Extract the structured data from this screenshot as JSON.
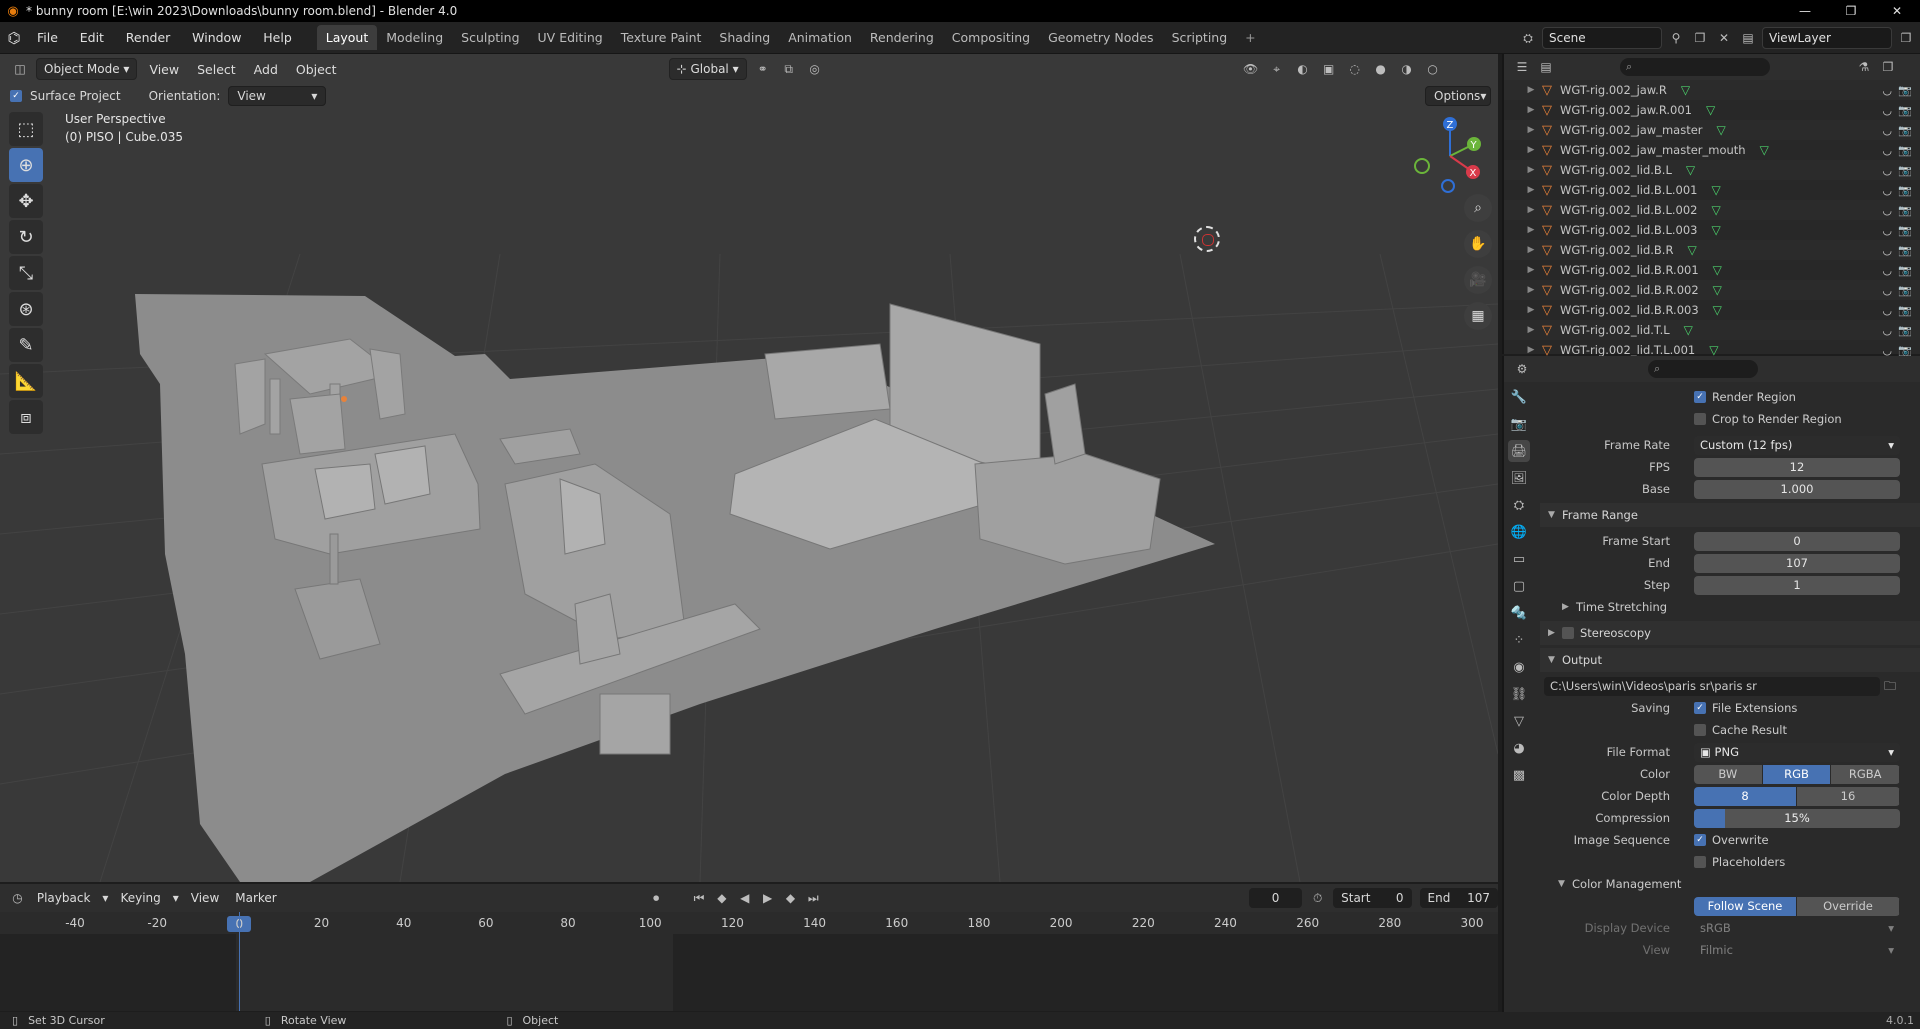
{
  "window": {
    "title": "* bunny room [E:\\win 2023\\Downloads\\bunny room.blend] - Blender 4.0",
    "min_glyph": "—",
    "max_glyph": "❐",
    "close_glyph": "✕"
  },
  "menu": [
    "File",
    "Edit",
    "Render",
    "Window",
    "Help"
  ],
  "workspaces": {
    "tabs": [
      "Layout",
      "Modeling",
      "Sculpting",
      "UV Editing",
      "Texture Paint",
      "Shading",
      "Animation",
      "Rendering",
      "Compositing",
      "Geometry Nodes",
      "Scripting"
    ],
    "active": "Layout",
    "add_glyph": "+"
  },
  "scene_selector": {
    "scene": "Scene",
    "view_layer": "ViewLayer"
  },
  "viewport": {
    "mode": "Object Mode",
    "menus": [
      "View",
      "Select",
      "Add",
      "Object"
    ],
    "transform_orientation": "Global",
    "surface_project_label": "Surface Project",
    "orientation_label": "Orientation:",
    "orientation_value": "View",
    "options_label": "Options",
    "perspective_text": "User Perspective",
    "object_text": "(0) PISO | Cube.035",
    "gizmo": {
      "x": "X",
      "y": "Y",
      "z": "Z"
    }
  },
  "timeline": {
    "menus": [
      "Playback",
      "Keying",
      "View",
      "Marker"
    ],
    "current_frame": "0",
    "start_label": "Start",
    "start_value": "0",
    "end_label": "End",
    "end_value": "107",
    "ruler": [
      "-40",
      "-20",
      "0",
      "20",
      "40",
      "60",
      "80",
      "100",
      "120",
      "140",
      "160",
      "180",
      "200",
      "220",
      "240",
      "260",
      "280",
      "300"
    ],
    "ruler_values": [
      -40,
      -20,
      0,
      20,
      40,
      60,
      80,
      100,
      120,
      140,
      160,
      180,
      200,
      220,
      240,
      260,
      280,
      300
    ],
    "playhead_frame": 0
  },
  "status_bar": {
    "left": "Set 3D Cursor",
    "middle": "Rotate View",
    "right": "Object",
    "version": "4.0.1"
  },
  "outliner": {
    "items": [
      "WGT-rig.002_jaw.R",
      "WGT-rig.002_jaw.R.001",
      "WGT-rig.002_jaw_master",
      "WGT-rig.002_jaw_master_mouth",
      "WGT-rig.002_lid.B.L",
      "WGT-rig.002_lid.B.L.001",
      "WGT-rig.002_lid.B.L.002",
      "WGT-rig.002_lid.B.L.003",
      "WGT-rig.002_lid.B.R",
      "WGT-rig.002_lid.B.R.001",
      "WGT-rig.002_lid.B.R.002",
      "WGT-rig.002_lid.B.R.003",
      "WGT-rig.002_lid.T.L",
      "WGT-rig.002_lid.T.L.001"
    ]
  },
  "properties": {
    "render_region": "Render Region",
    "crop_region": "Crop to Render Region",
    "frame_rate_label": "Frame Rate",
    "frame_rate_value": "Custom (12 fps)",
    "fps_label": "FPS",
    "fps_value": "12",
    "base_label": "Base",
    "base_value": "1.000",
    "frame_range_title": "Frame Range",
    "frame_start_label": "Frame Start",
    "frame_start_value": "0",
    "end_label": "End",
    "end_value": "107",
    "step_label": "Step",
    "step_value": "1",
    "time_stretching": "Time Stretching",
    "stereoscopy": "Stereoscopy",
    "output_title": "Output",
    "output_path": "C:\\Users\\win\\Videos\\paris sr\\paris sr",
    "saving_label": "Saving",
    "file_extensions": "File Extensions",
    "cache_result": "Cache Result",
    "file_format_label": "File Format",
    "file_format_value": "PNG",
    "color_label": "Color",
    "color_options": [
      "BW",
      "RGB",
      "RGBA"
    ],
    "color_selected": "RGB",
    "color_depth_label": "Color Depth",
    "color_depth_options": [
      "8",
      "16"
    ],
    "color_depth_selected": "8",
    "compression_label": "Compression",
    "compression_value": "15%",
    "compression_fraction": 0.15,
    "image_sequence_label": "Image Sequence",
    "overwrite": "Overwrite",
    "placeholders": "Placeholders",
    "color_management_title": "Color Management",
    "follow_scene": "Follow Scene",
    "override": "Override",
    "display_device_label": "Display Device",
    "display_device_value": "sRGB",
    "view_label": "View",
    "view_value": "Filmic"
  },
  "colors": {
    "accent": "#4772b3",
    "viewport_bg": "#393939",
    "mesh": "#9c9c9c",
    "object_orange": "#e8823a",
    "vertex_green": "#4bd16b"
  }
}
